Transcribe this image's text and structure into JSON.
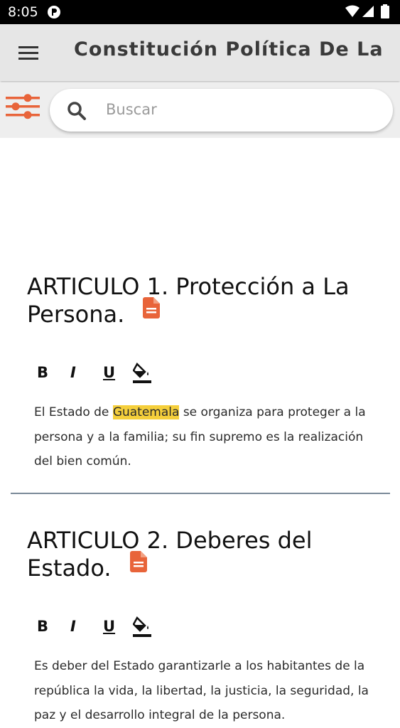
{
  "status_bar": {
    "time": "8:05"
  },
  "app_bar": {
    "title": "Constitución Política De La ..."
  },
  "search": {
    "placeholder": "Buscar"
  },
  "toolbar": {
    "bold": "B",
    "italic": "I",
    "underline": "U"
  },
  "articles": [
    {
      "title": "ARTICULO 1. Protección a La Persona.",
      "body_before": "El Estado de ",
      "body_highlight": "Guatemala",
      "body_after": " se organiza para proteger a la persona y a la familia; su fin supremo es la realización del bien común."
    },
    {
      "title": "ARTICULO 2. Deberes del Estado.",
      "body": "Es deber del Estado garantizarle a los habitantes de la república la vida, la libertad, la justicia, la seguridad, la paz y el desarrollo integral de la persona."
    }
  ],
  "colors": {
    "accent": "#e8643a",
    "highlight": "#f5cf3b",
    "divider": "#7b8a99"
  }
}
